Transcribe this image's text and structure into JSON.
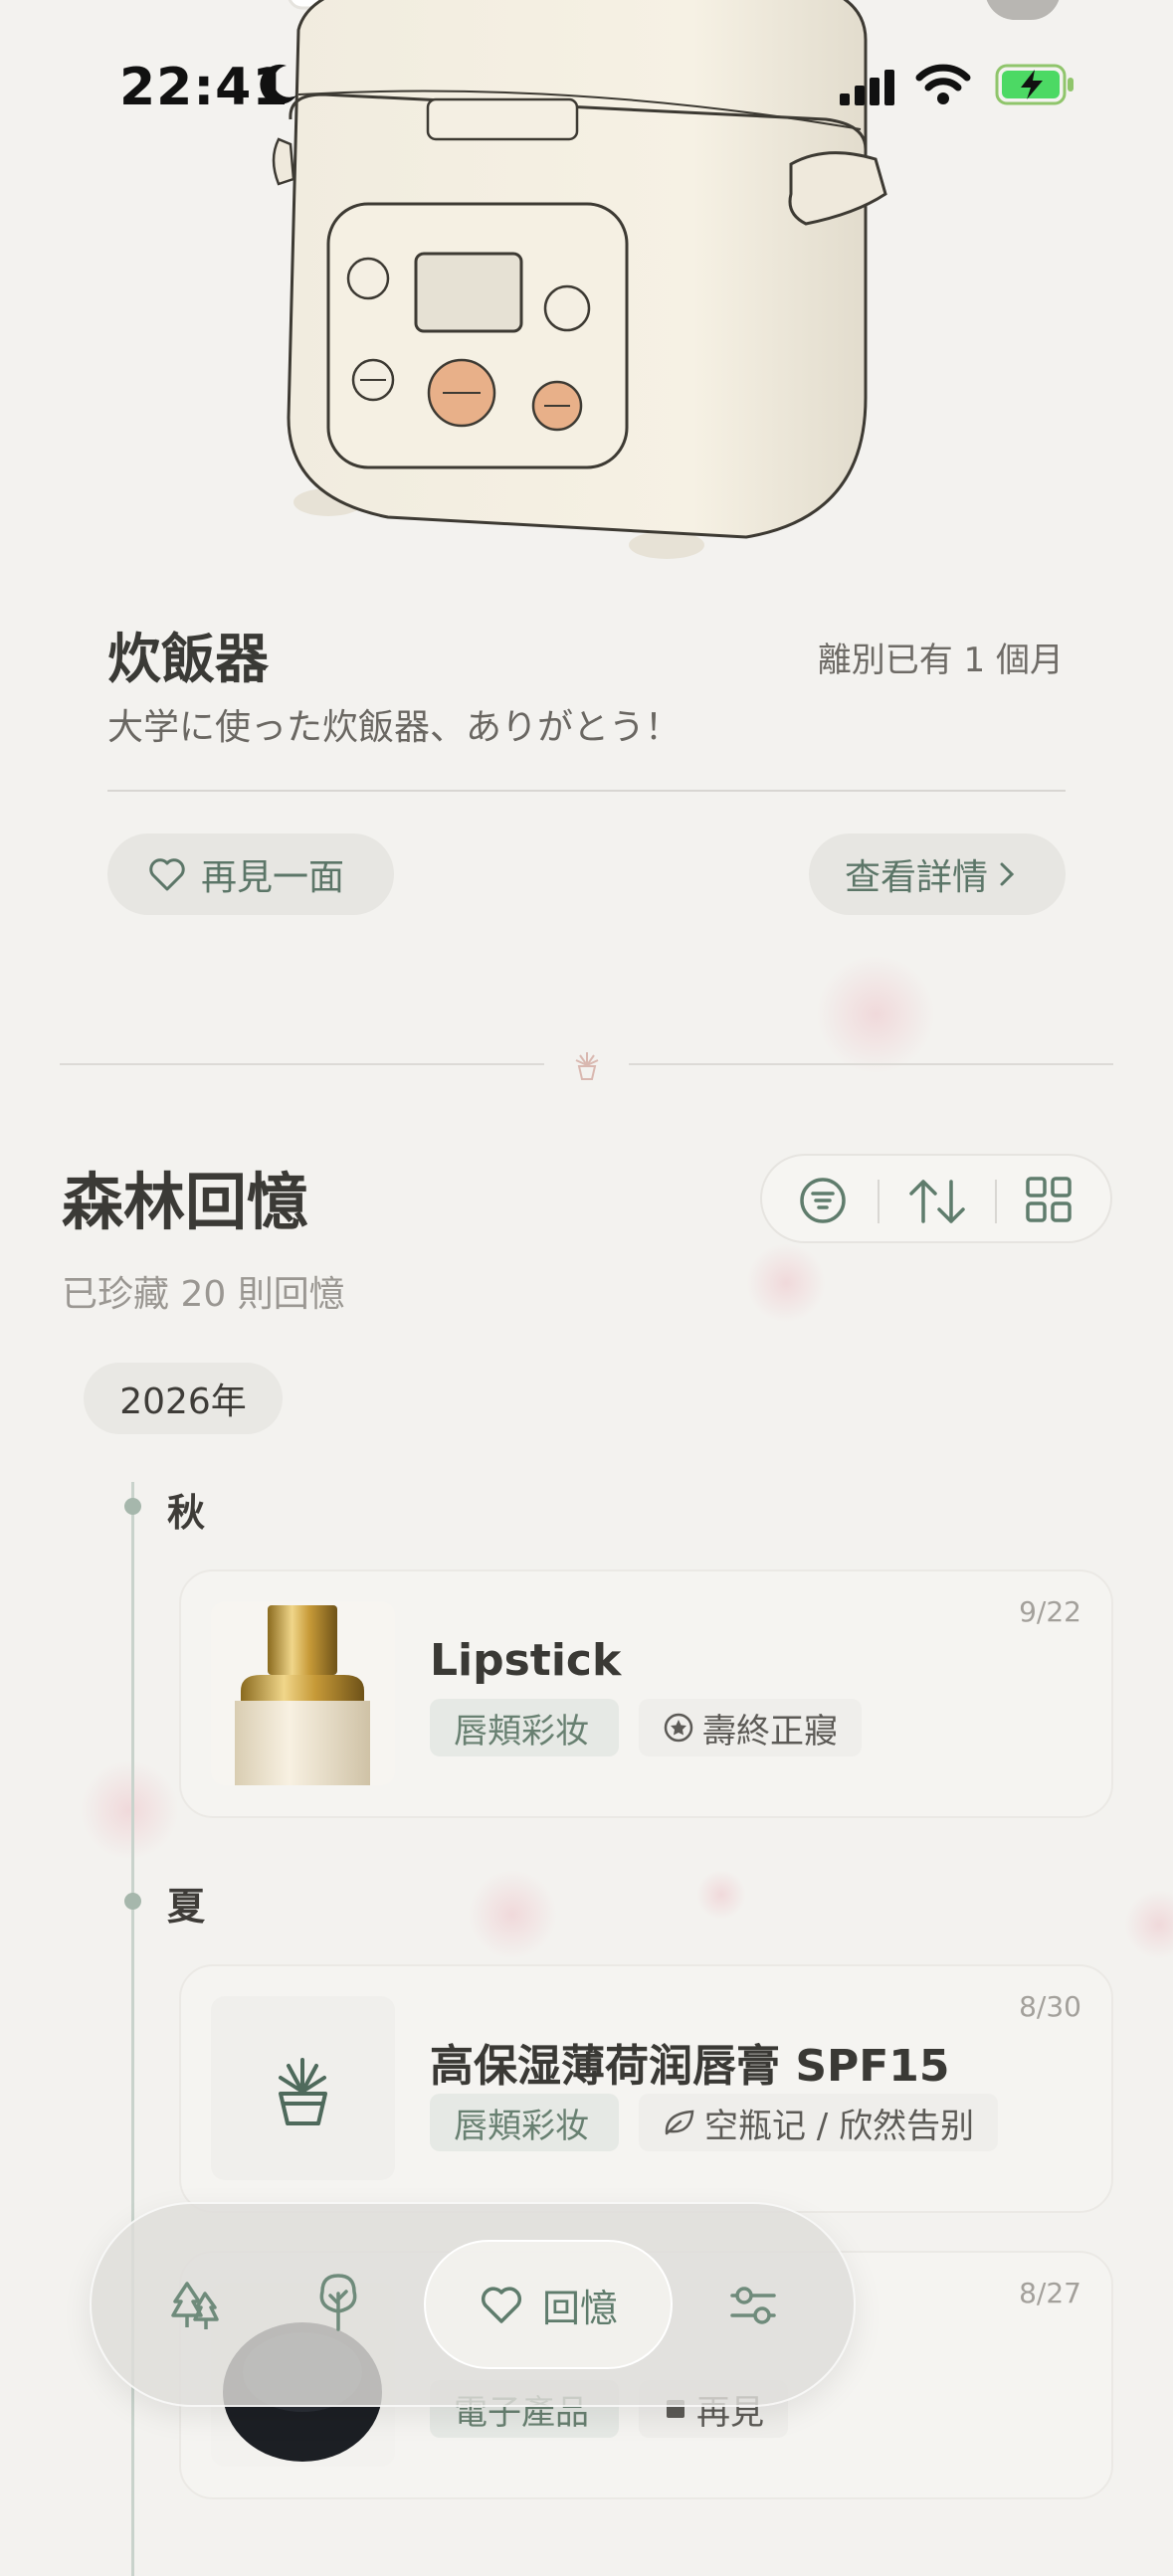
{
  "status_bar": {
    "time": "22:41"
  },
  "item": {
    "name": "炊飯器",
    "since_label": "離別已有 1 個月",
    "note": "大学に使った炊飯器、ありがとう！",
    "see_again_label": "再見一面",
    "details_label": "查看詳情"
  },
  "section": {
    "title": "森林回憶",
    "count_label": "已珍藏 20 則回憶",
    "toolbar_icons": [
      "filter-icon",
      "sort-icon",
      "grid-view-icon"
    ]
  },
  "year_label": "2026年",
  "timeline": [
    {
      "season": "秋",
      "entries": [
        {
          "name": "Lipstick",
          "date": "9/22",
          "category": "唇頬彩妆",
          "fate": "壽終正寢",
          "fate_icon": "star-badge-icon"
        }
      ]
    },
    {
      "season": "夏",
      "entries": [
        {
          "name": "高保湿薄荷润唇膏 SPF15",
          "date": "8/30",
          "category": "唇頬彩妆",
          "fate": "空瓶记 / 欣然告别",
          "fate_icon": "leaf-icon"
        },
        {
          "name": "",
          "date": "8/27",
          "category": "電子產品",
          "fate": "再見",
          "fate_icon": "square-icon"
        }
      ]
    }
  ],
  "nav": {
    "items": [
      "forest-icon",
      "tree-icon",
      "memories-tab",
      "settings-icon"
    ],
    "active_label": "回憶"
  },
  "colors": {
    "accent": "#5f7c6c",
    "background": "#f3f2ef",
    "timeline": "#a6b7ac"
  }
}
